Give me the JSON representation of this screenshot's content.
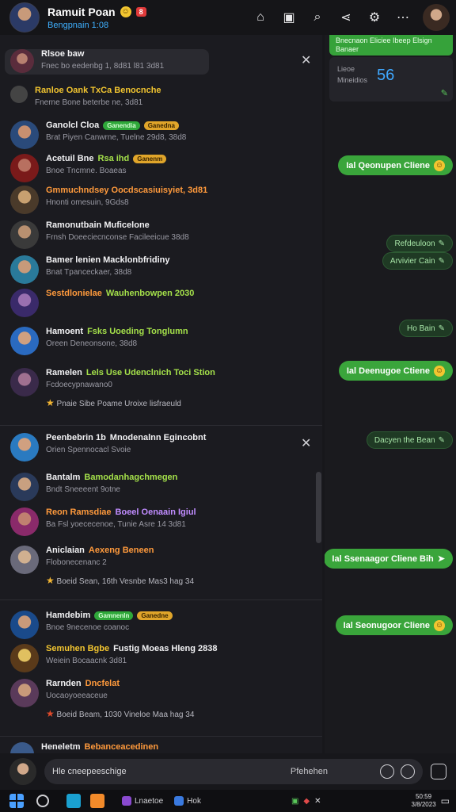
{
  "topbar": {
    "title": "Ramuit Poan",
    "badge": "8",
    "subtitle": "Bengpnain 1:08",
    "icons": [
      "home-icon",
      "inbox-icon",
      "search-icon",
      "share-icon",
      "settings-icon",
      "more-icon"
    ]
  },
  "left_rows": [
    {
      "l1": "Rlsoe baw",
      "l2": "Fnec bo eedenbg 1, 8d81 l81 3d81"
    },
    {
      "l1": "Ranloe Oank TxCa Benocnche",
      "l2": "Fnerne Bone beterbe ne, 3d81"
    },
    {
      "l1": "Ganolcl Cloa",
      "b1": "Ganendia",
      "b2": "Ganedna",
      "l2": "Brat Piyen Canwrne, Tuelne 29d8, 38d8"
    },
    {
      "l1": "Acetuil Bne",
      "hl": "Rsa ihd",
      "b2": "Ganenm",
      "l2": "Bnoe Tncmne. Boaeas"
    },
    {
      "l1": "Gmmuchndsey Oocdscasiuisyiet, 3d81",
      "l2": "Hnonti omesuin, 9Gds8"
    },
    {
      "l1": "Ramonutbain Muficelone",
      "l2": "Frnsh Doeeciecnconse Facileeicue 38d8"
    },
    {
      "l1": "Bamer lenien Macklonbfridiny",
      "l2": "Bnat Tpanceckaer, 38d8"
    },
    {
      "l1": "Sestdlonielae",
      "hl": "Wauhenbowpen 2030",
      "l2": ""
    },
    {
      "l1": "Hamoent",
      "hl": "Fsks Uoeding Tonglumn",
      "l2": "Oreen Deneonsone, 38d8"
    },
    {
      "l1": "Ramelen",
      "hl": "Lels Use Udenclnich Toci Stion",
      "l2": "Fcdoecypnawano0",
      "l3": "Pnaie Sibe Poame Uroixe lisfraeuld"
    },
    {
      "l1": "Peenbebrin 1b",
      "hl": "Mnodenalnn Egincobnt",
      "l2": "Orien Spennocacl Svoie"
    },
    {
      "l1": "Bantalm",
      "hl": "Bamodanhagchmegen",
      "l2": "Bndt Sneeeent 9otne"
    },
    {
      "l1": "Reon Ramsdiae",
      "hl": "Boeel Oenaain Igiul",
      "l2": "Ba Fsl yoececenoe, Tunie Asre 14 3d81"
    },
    {
      "l1": "Aniclaian",
      "hl": "Aexeng Beneen",
      "l2": "Flobonecenanc 2",
      "l3": "Boeid Sean, 16th Vesnbe Mas3 hag 34"
    },
    {
      "l1": "Hamdebim",
      "b1": "Gamnenln",
      "b2": "Ganedne",
      "l2": "Bnoe 9necenoe coanoc"
    },
    {
      "l1": "Semuhen Bgbe",
      "hl": "Fustig Moeas Hleng 2838",
      "l2": "Weiein Bocaacnk 3d81"
    },
    {
      "l1": "Rarnden",
      "hl": "Dncfelat",
      "l2": "Uocaoyoeeaceue",
      "l3": "Boeid Beam, 1030 Vineloe Maa hag 34"
    },
    {
      "l1": "Heneletm",
      "hl": "Bebanceacedinen",
      "l2": ""
    }
  ],
  "right_panel": {
    "header": "Bnecnaon Eliciee Ibeep Elsign Banaer",
    "mini_label1": "Lieoe",
    "mini_label2": "Mineidios",
    "mini_value": "56",
    "bubbles": [
      "Ial Qeonupen Cliene",
      "Ial Deenugoe Ctiene",
      "Ial Ssenaagor Cliene Bih",
      "Ial Seonugoor Cliene"
    ],
    "pills": [
      "Refdeuloon",
      "Arvivier Cain",
      "Ho Bain",
      "Dacyen the Bean"
    ]
  },
  "composer": {
    "placeholder": "Hle cneepeeschige",
    "hint": "Pfehehen"
  },
  "taskbar": {
    "app1": "Lnaetoe",
    "app2": "Hok",
    "time": "50:59",
    "date": "3/8/2023"
  }
}
